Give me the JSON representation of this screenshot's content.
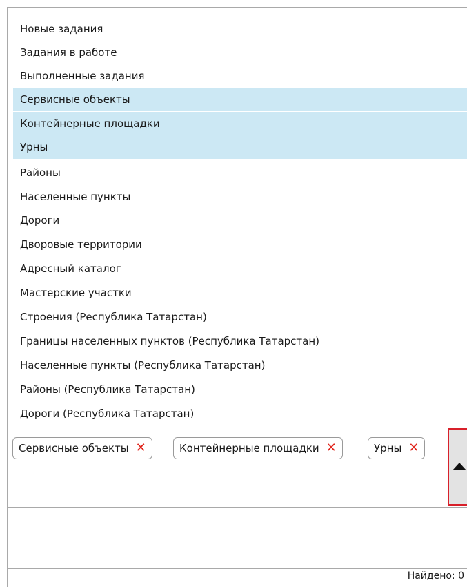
{
  "dropdown": {
    "items": [
      {
        "label": "Новые задания",
        "selected": false
      },
      {
        "label": "Задания в работе",
        "selected": false
      },
      {
        "label": "Выполненные задания",
        "selected": false
      },
      {
        "label": "Сервисные объекты",
        "selected": true
      },
      {
        "label": "Контейнерные площадки",
        "selected": true
      },
      {
        "label": "Урны",
        "selected": true
      },
      {
        "label": "Районы",
        "selected": false
      },
      {
        "label": "Населенные пункты",
        "selected": false
      },
      {
        "label": "Дороги",
        "selected": false
      },
      {
        "label": "Дворовые территории",
        "selected": false
      },
      {
        "label": "Адресный каталог",
        "selected": false
      },
      {
        "label": "Мастерские участки",
        "selected": false
      },
      {
        "label": "Строения (Республика Татарстан)",
        "selected": false
      },
      {
        "label": "Границы населенных пунктов (Республика Татарстан)",
        "selected": false
      },
      {
        "label": "Населенные пункты (Республика Татарстан)",
        "selected": false
      },
      {
        "label": "Районы (Республика Татарстан)",
        "selected": false
      },
      {
        "label": "Дороги (Республика Татарстан)",
        "selected": false
      }
    ]
  },
  "tags": [
    {
      "label": "Сервисные объекты",
      "remove_icon": "close-icon"
    },
    {
      "label": "Контейнерные площадки",
      "remove_icon": "close-icon"
    },
    {
      "label": "Урны",
      "remove_icon": "close-icon"
    }
  ],
  "toggle_icon": "triangle-up-icon",
  "textarea": {
    "value": ""
  },
  "status": {
    "found_text": "Найдено: 0"
  },
  "colors": {
    "selection": "#cce8f4",
    "remove_x": "#e0241b",
    "focus_border": "#d8202a"
  }
}
